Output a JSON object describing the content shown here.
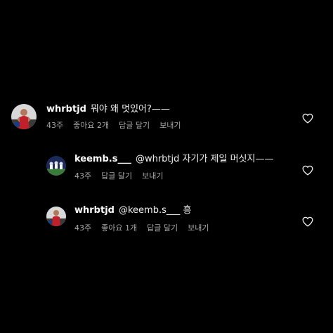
{
  "colors": {
    "background": "#000000",
    "text": "#f5f5f5",
    "meta": "#a8a8a8"
  },
  "comments": [
    {
      "username": "whrbtjd",
      "text": "뭐야 왜 멋있어?——",
      "time": "43주",
      "likes": "좋아요 2개",
      "reply": "답글 달기",
      "send": "보내기",
      "avatar_icon": "soccer-player-avatar"
    },
    {
      "username": "keemb.s___",
      "text": "@whrbtjd 자기가 제일 머싯지——",
      "time": "43주",
      "reply": "답글 달기",
      "send": "보내기",
      "avatar_icon": "team-photo-avatar"
    },
    {
      "username": "whrbtjd",
      "text": "@keemb.s___ 흥",
      "time": "43주",
      "likes": "좋아요 1개",
      "reply": "답글 달기",
      "send": "보내기",
      "avatar_icon": "soccer-player-avatar"
    }
  ],
  "icons": {
    "like": "heart-outline-icon"
  }
}
